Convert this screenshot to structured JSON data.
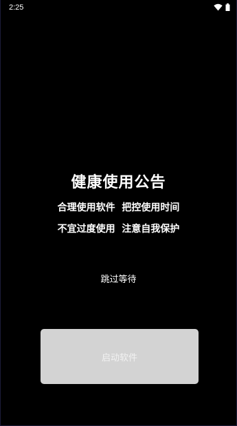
{
  "status_bar": {
    "time": "2:25",
    "icons": [
      "wifi-icon",
      "battery-icon"
    ]
  },
  "notice": {
    "title": "健康使用公告",
    "line1": "合理使用软件  把控使用时间",
    "line2": "不宜过度使用  注意自我保护"
  },
  "skip": {
    "label": "跳过等待"
  },
  "launch_button": {
    "label": "启动软件"
  },
  "colors": {
    "background": "#000000",
    "button": "#d3d3d3",
    "text": "#ffffff"
  }
}
